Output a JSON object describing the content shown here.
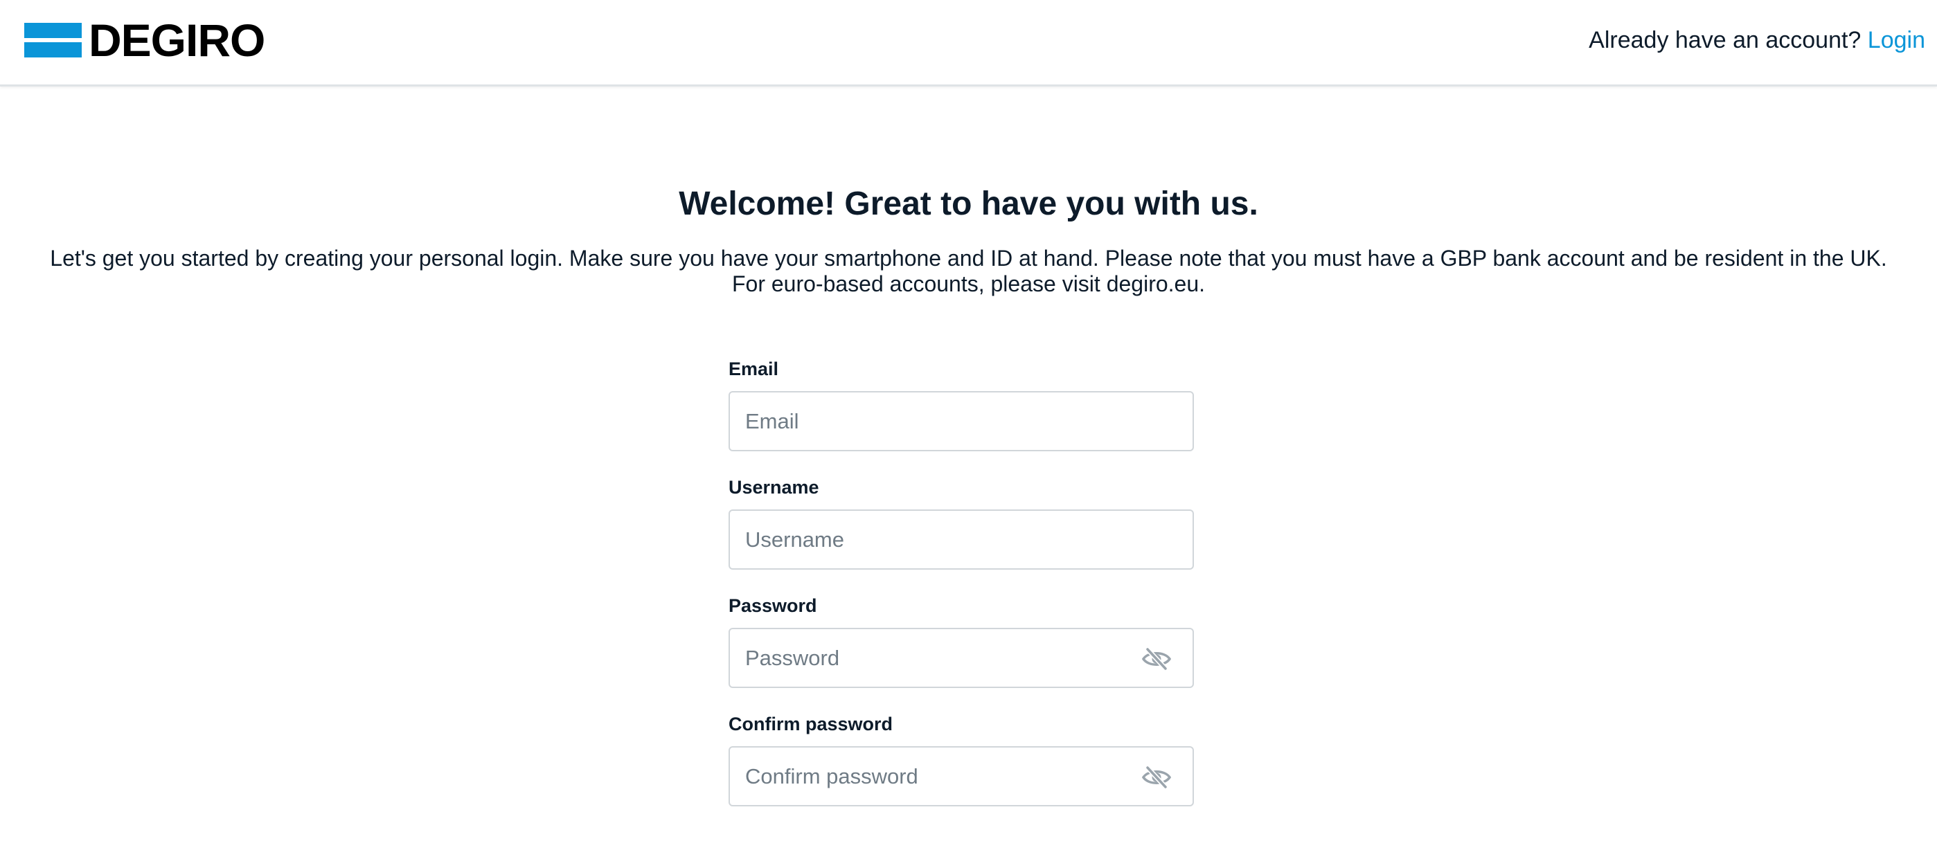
{
  "header": {
    "brand": "DEGIRO",
    "account_prompt": "Already have an account?",
    "login_link": "Login"
  },
  "main": {
    "title": "Welcome! Great to have you with us.",
    "intro_line1": "Let's get you started by creating your personal login. Make sure you have your smartphone and ID at hand. Please note that you must have a GBP bank account and be resident in the UK.",
    "intro_line2": "For euro-based accounts, please visit degiro.eu."
  },
  "form": {
    "email": {
      "label": "Email",
      "placeholder": "Email",
      "value": ""
    },
    "username": {
      "label": "Username",
      "placeholder": "Username",
      "value": ""
    },
    "password": {
      "label": "Password",
      "placeholder": "Password",
      "value": "",
      "toggle_icon": "eye-slash-icon"
    },
    "confirm_password": {
      "label": "Confirm password",
      "placeholder": "Confirm password",
      "value": "",
      "toggle_icon": "eye-slash-icon"
    }
  },
  "colors": {
    "brand_blue": "#0b95d8",
    "text": "#0d1b2a",
    "border": "#d1d6da",
    "icon": "#9aa4ac"
  }
}
